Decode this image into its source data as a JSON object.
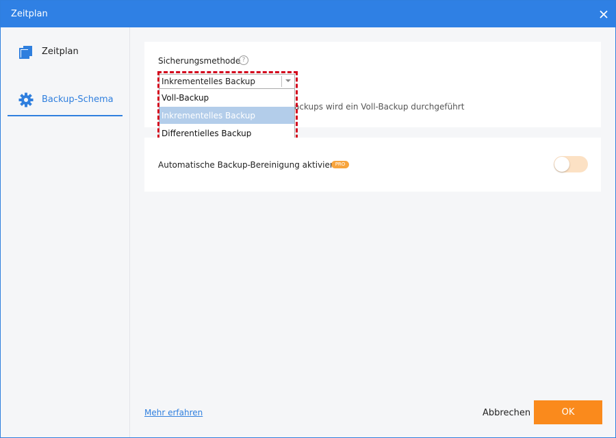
{
  "window": {
    "title": "Zeitplan"
  },
  "sidebar": {
    "items": [
      {
        "label": "Zeitplan",
        "icon": "schedule-icon"
      },
      {
        "label": "Backup-Schema",
        "icon": "gear-icon",
        "active": true
      }
    ]
  },
  "method": {
    "label": "Sicherungsmethode",
    "selected": "Inkrementelles Backup",
    "options": [
      "Voll-Backup",
      "Inkrementelles Backup",
      "Differentielles Backup"
    ],
    "hint": "ackups wird ein Voll-Backup durchgeführt"
  },
  "cleanup": {
    "label": "Automatische Backup-Bereinigung aktivieren",
    "badge": "PRO",
    "enabled": false
  },
  "footer": {
    "link": "Mehr erfahren",
    "cancel": "Abbrechen",
    "ok": "OK"
  },
  "colors": {
    "accent": "#2f80e4",
    "ok_button": "#fa8a1c",
    "highlight": "#d3001b"
  }
}
